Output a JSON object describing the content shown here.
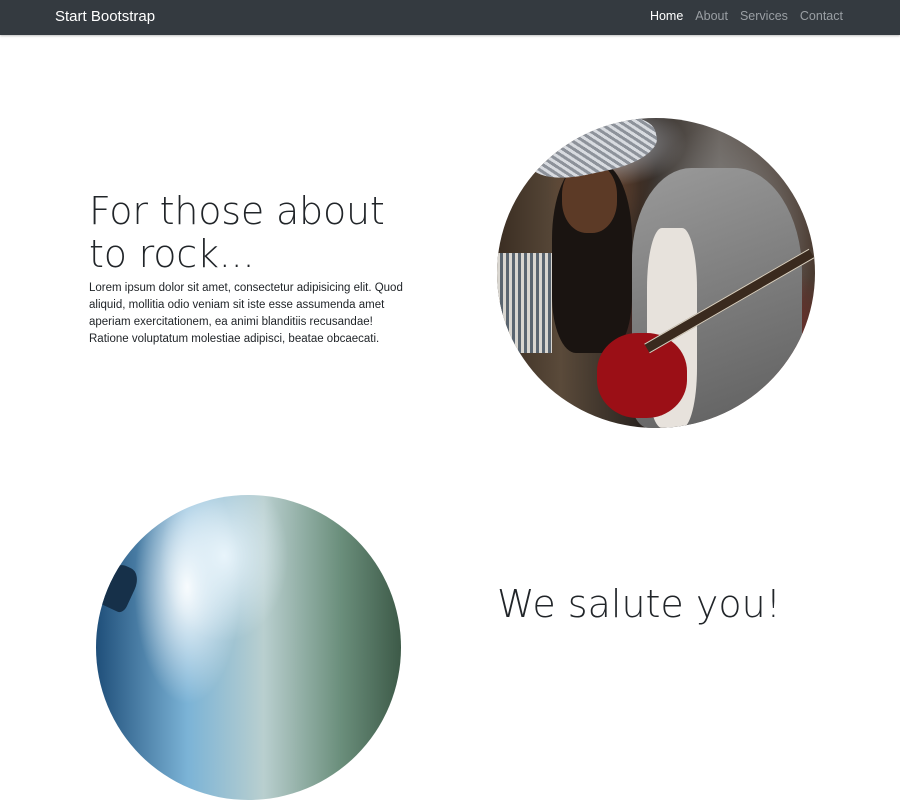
{
  "navbar": {
    "brand": "Start Bootstrap",
    "links": [
      {
        "label": "Home",
        "active": true
      },
      {
        "label": "About",
        "active": false
      },
      {
        "label": "Services",
        "active": false
      },
      {
        "label": "Contact",
        "active": false
      }
    ]
  },
  "sections": [
    {
      "heading": "For those about to rock...",
      "text": "Lorem ipsum dolor sit amet, consectetur adipisicing elit. Quod aliquid, mollitia odio veniam sit iste esse assumenda amet aperiam exercitationem, ea animi blanditiis recusandae! Ratione voluptatum molestiae adipisci, beatae obcaecati."
    },
    {
      "heading": "We salute you!"
    }
  ],
  "colors": {
    "navbar_bg": "#343a40",
    "nav_active": "#ffffff",
    "nav_inactive": "#9a9fa4",
    "text": "#212529"
  }
}
